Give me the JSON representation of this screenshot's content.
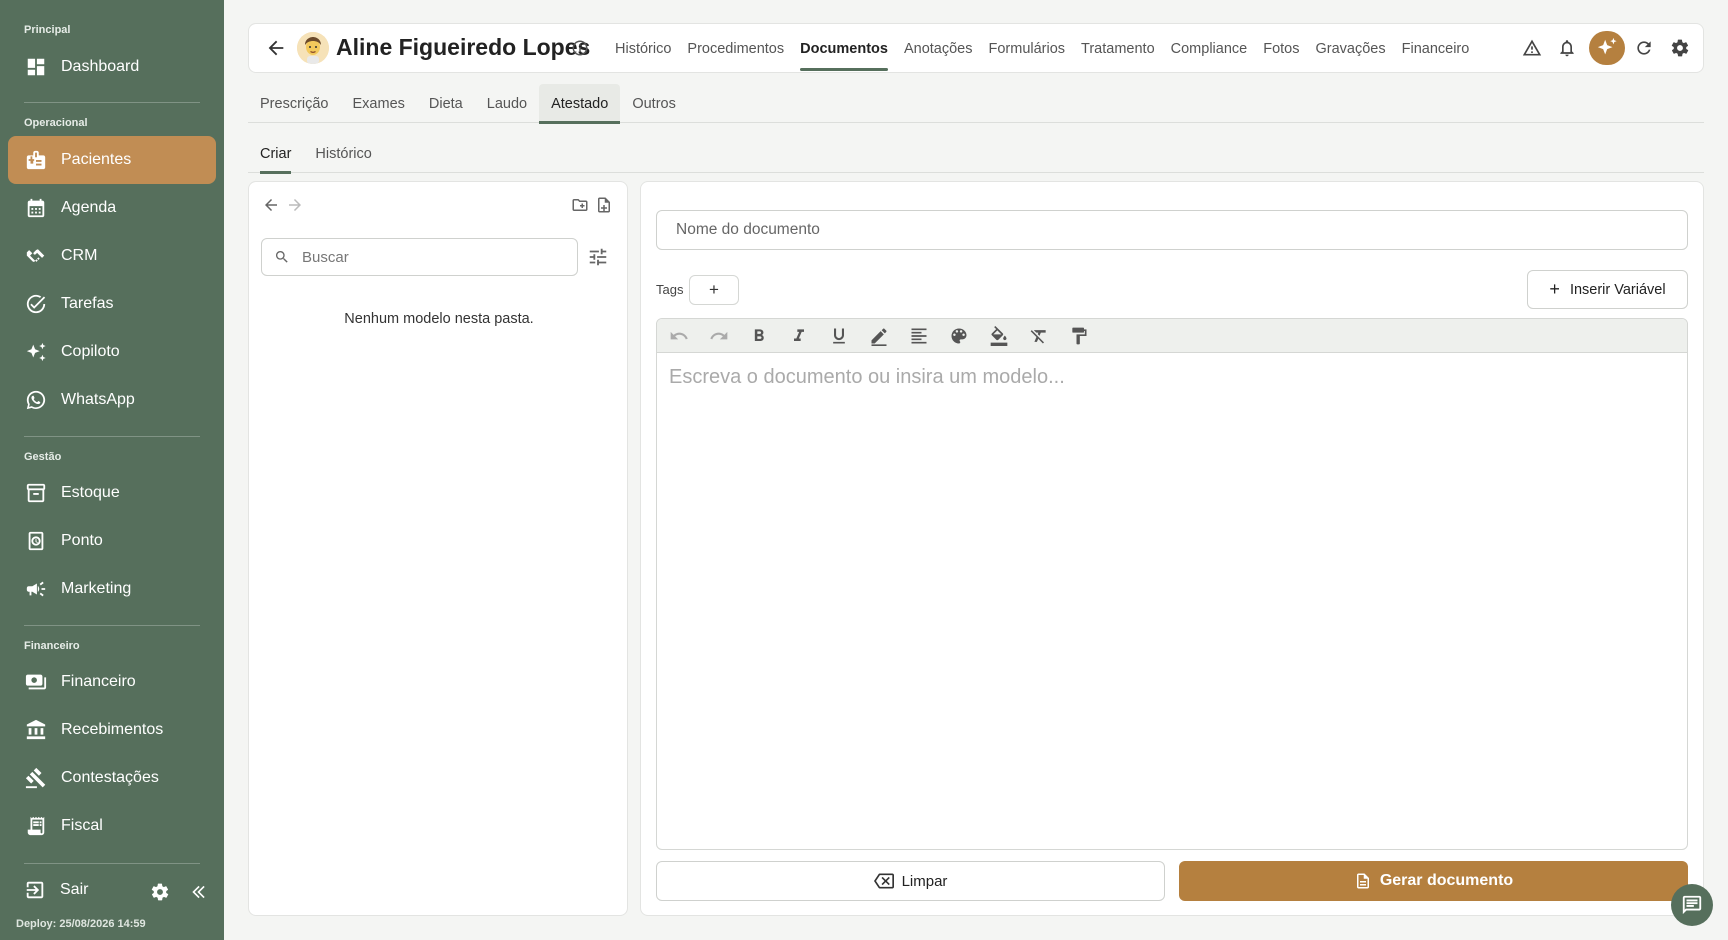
{
  "sidebar": {
    "sections": {
      "principal": "Principal",
      "operacional": "Operacional",
      "gestao": "Gestão",
      "financeiro": "Financeiro"
    },
    "items": {
      "dashboard": "Dashboard",
      "pacientes": "Pacientes",
      "agenda": "Agenda",
      "crm": "CRM",
      "tarefas": "Tarefas",
      "copiloto": "Copiloto",
      "whatsapp": "WhatsApp",
      "estoque": "Estoque",
      "ponto": "Ponto",
      "marketing": "Marketing",
      "financeiro": "Financeiro",
      "recebimentos": "Recebimentos",
      "contestacoes": "Contestações",
      "fiscal": "Fiscal"
    },
    "active_item": "Pacientes",
    "logout_label": "Sair",
    "deploy_text": "Deploy: 25/08/2026 14:59"
  },
  "header": {
    "patient_name": "Aline Figueiredo Lopes",
    "tabs": [
      "Histórico",
      "Procedimentos",
      "Documentos",
      "Anotações",
      "Formulários",
      "Tratamento",
      "Compliance",
      "Fotos",
      "Gravações",
      "Financeiro"
    ],
    "active_tab": "Documentos"
  },
  "doc_tabs": {
    "items": [
      "Prescrição",
      "Exames",
      "Dieta",
      "Laudo",
      "Atestado",
      "Outros"
    ],
    "active": "Atestado"
  },
  "mode_tabs": {
    "items": [
      "Criar",
      "Histórico"
    ],
    "active": "Criar"
  },
  "templates_panel": {
    "search_placeholder": "Buscar",
    "empty_message": "Nenhum modelo nesta pasta."
  },
  "editor": {
    "doc_name_placeholder": "Nome do documento",
    "tags_label": "Tags",
    "tags_add": "+",
    "insert_variable_label": "Inserir Variável",
    "body_placeholder": "Escreva o documento ou insira um modelo...",
    "clear_label": "Limpar",
    "generate_label": "Gerar documento"
  },
  "colors": {
    "sidebar_bg": "#566f5c",
    "accent": "#c18d54",
    "primary_button": "#b5803f"
  }
}
